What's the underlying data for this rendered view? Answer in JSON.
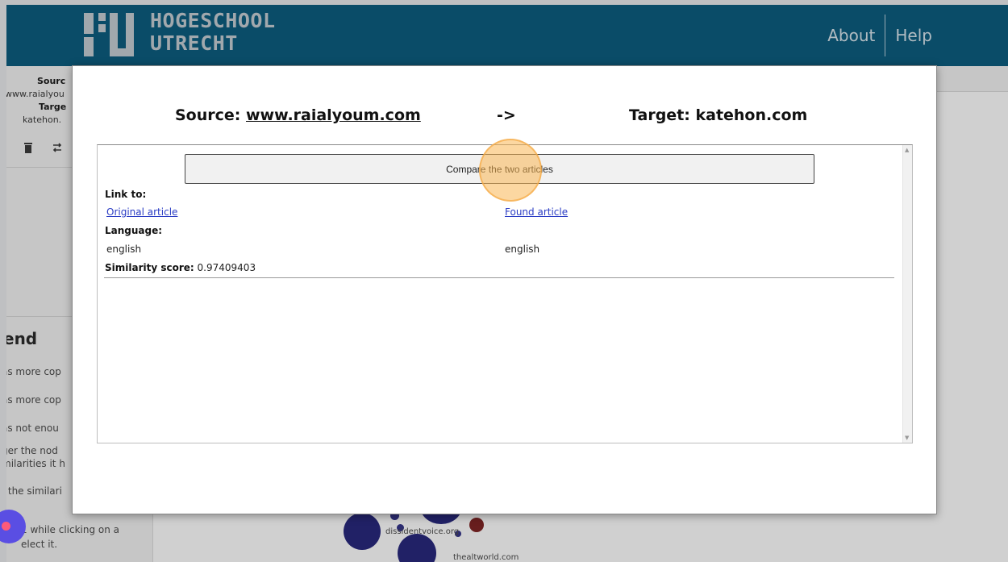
{
  "header": {
    "logo_line1": "HOGESCHOOL",
    "logo_line2": "UTRECHT",
    "nav_about": "About",
    "nav_help": "Help",
    "brand_color": "#02567a"
  },
  "left_panel": {
    "source_label": "Sourc",
    "source_value": "www.raialyou",
    "target_label": "Targe",
    "target_value": "katehon.",
    "legend_title": "end",
    "legend_lines": [
      "as more cop",
      "as more cop",
      "as not enou",
      "ger the nod",
      "milarities it h",
      "/ the similari"
    ],
    "footer_line1": "1 while clicking on a",
    "footer_line2": "elect it."
  },
  "graph": {
    "labels": [
      "dissidentvoice.org",
      "thealtworld.com"
    ]
  },
  "modal": {
    "source_prefix": "Source: ",
    "source_site": "www.raialyoum.com",
    "arrow": "->",
    "target_text": "Target: katehon.com",
    "compare_button": "Compare the two articles",
    "link_to_label": "Link to:",
    "original_link": "Original article",
    "found_link": "Found article",
    "language_label": "Language:",
    "source_language": "english",
    "target_language": "english",
    "similarity_label": "Similarity score:",
    "similarity_value": "0.97409403"
  }
}
